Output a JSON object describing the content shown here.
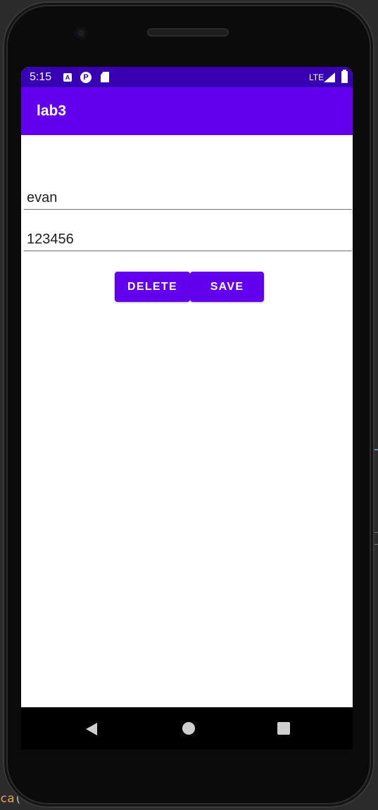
{
  "ide": {
    "code_fragment": "ca",
    "code_paren": "("
  },
  "status_bar": {
    "time": "5:15",
    "notification_icon_a": "A",
    "notification_icon_p": "P",
    "network": "LTE",
    "icons": [
      "a-notification-icon",
      "p-notification-icon",
      "sd-card-icon",
      "signal-icon",
      "battery-icon"
    ]
  },
  "app_bar": {
    "title": "lab3"
  },
  "form": {
    "name_value": "evan",
    "code_value": "123456"
  },
  "buttons": {
    "delete_label": "DELETE",
    "save_label": "SAVE"
  },
  "nav_bar": {
    "icons": [
      "back-icon",
      "home-icon",
      "recents-icon"
    ]
  },
  "colors": {
    "status_bar": "#3700b3",
    "primary": "#6200ee",
    "ide_background": "#2b2b2b"
  }
}
